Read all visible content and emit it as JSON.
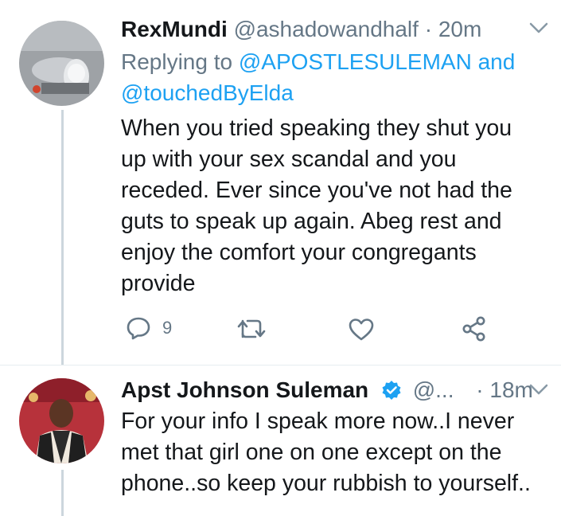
{
  "tweet1": {
    "display_name": "RexMundi",
    "handle": "@ashadowandhalf",
    "separator": "·",
    "time": "20m",
    "replying_prefix": "Replying to",
    "reply_mention_1": "@APOSTLESULEMAN",
    "reply_and": "and",
    "reply_mention_2": "@touchedByElda",
    "text": "When you tried speaking they shut you\nup with your sex scandal and you\nreceded. Ever since you've not had the\nguts to speak up again. Abeg rest and\nenjoy the comfort your congregants\nprovide",
    "reply_count": "9",
    "icons": [
      "reply-icon",
      "retweet-icon",
      "like-icon",
      "share-icon",
      "chevron-down-icon"
    ]
  },
  "tweet2": {
    "display_name": "Apst Johnson Suleman",
    "handle": "@...",
    "separator": "·",
    "time": "18m",
    "text": "For your info I speak more now..I never\nmet that girl one on one except on the\nphone..so keep your rubbish to yourself..",
    "icons": [
      "verified-badge-icon",
      "chevron-down-icon"
    ]
  },
  "colors": {
    "text": "#14171a",
    "secondary": "#657786",
    "link": "#1da1f2",
    "thread_line": "#ccd6dd",
    "verified": "#1da1f2"
  }
}
